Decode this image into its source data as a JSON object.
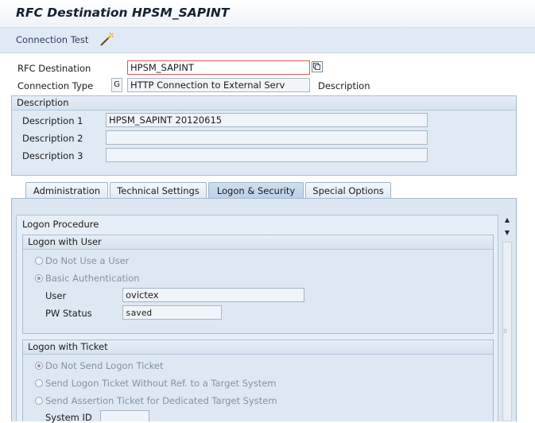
{
  "window": {
    "title": "RFC Destination HPSM_SAPINT"
  },
  "toolbar": {
    "connection_test": "Connection Test",
    "icon": "pencil-wand-icon"
  },
  "header": {
    "rfc_destination_label": "RFC Destination",
    "rfc_destination_value": "HPSM_SAPINT",
    "connection_type_label": "Connection Type",
    "connection_type_code": "G",
    "connection_type_value": "HTTP Connection to External Serv",
    "description_label": "Description"
  },
  "description": {
    "title": "Description",
    "d1_label": "Description 1",
    "d1_value": "HPSM_SAPINT 20120615",
    "d2_label": "Description 2",
    "d2_value": "",
    "d3_label": "Description 3",
    "d3_value": ""
  },
  "tabs": [
    "Administration",
    "Technical Settings",
    "Logon & Security",
    "Special Options"
  ],
  "active_tab": "Logon & Security",
  "logon_procedure": {
    "title": "Logon Procedure",
    "user_group": {
      "title": "Logon with User",
      "option_no_user": "Do Not Use a User",
      "option_basic": "Basic Authentication",
      "user_label": "User",
      "user_value": "ovictex",
      "pw_label": "PW Status",
      "pw_value": "saved"
    },
    "ticket_group": {
      "title": "Logon with Ticket",
      "option_no_ticket": "Do Not Send Logon Ticket",
      "option_send_ticket": "Send Logon Ticket Without Ref. to a Target System",
      "option_assertion": "Send Assertion Ticket for Dedicated Target System",
      "system_id_label": "System ID",
      "system_id_value": ""
    }
  },
  "colors": {
    "panel": "#dce7f2",
    "toolbar": "#e0eaf5",
    "focus_border": "#e05a4a"
  }
}
